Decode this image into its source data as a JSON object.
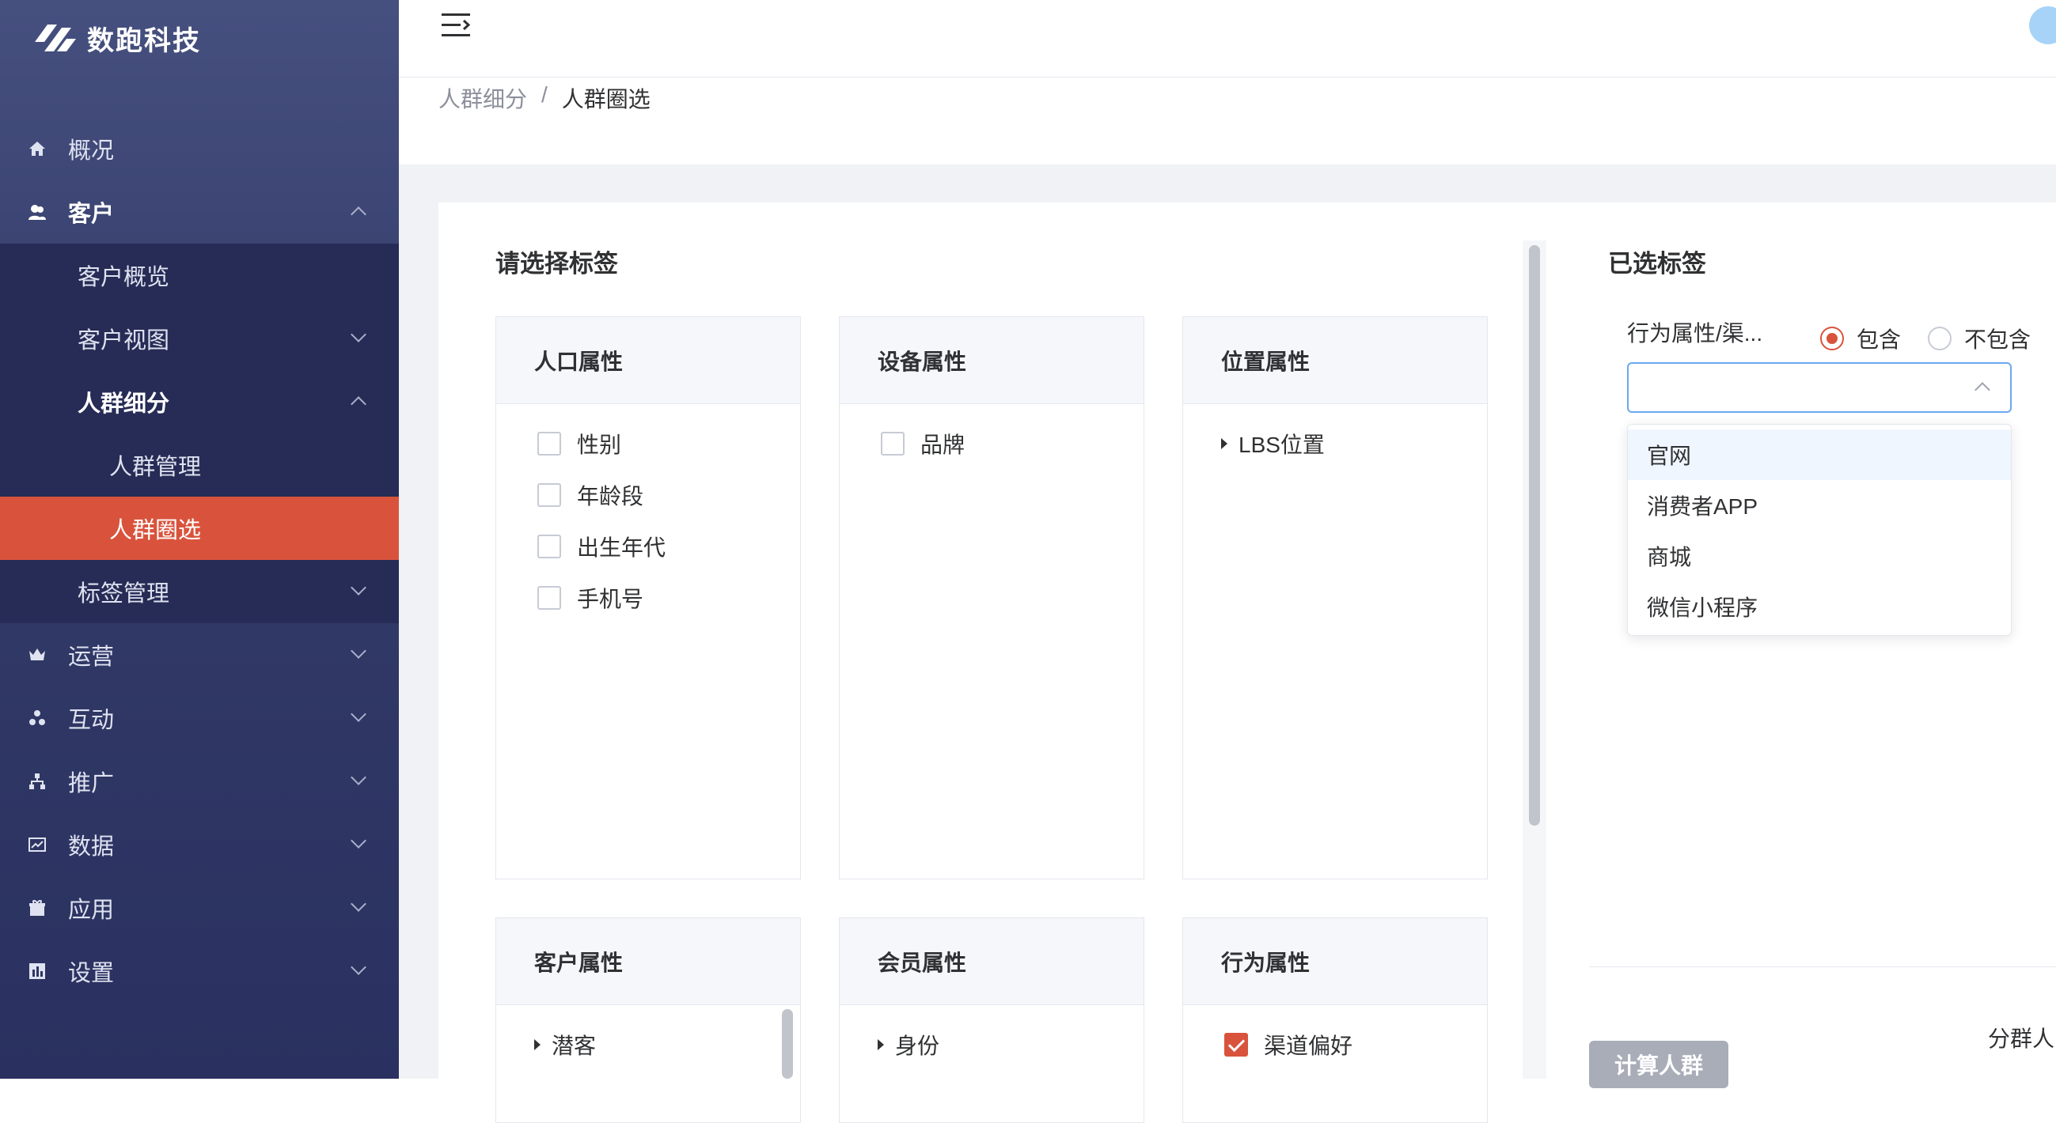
{
  "brand": {
    "name": "数跑科技"
  },
  "sidebar": {
    "items": [
      {
        "label": "概况",
        "icon": "home-icon"
      },
      {
        "label": "客户",
        "icon": "user-group-icon"
      },
      {
        "label": "客户概览"
      },
      {
        "label": "客户视图"
      },
      {
        "label": "人群细分"
      },
      {
        "label": "人群管理"
      },
      {
        "label": "人群圈选"
      },
      {
        "label": "标签管理"
      },
      {
        "label": "运营",
        "icon": "crown-icon"
      },
      {
        "label": "互动",
        "icon": "interaction-icon"
      },
      {
        "label": "推广",
        "icon": "sitemap-icon"
      },
      {
        "label": "数据",
        "icon": "chart-icon"
      },
      {
        "label": "应用",
        "icon": "gift-icon"
      },
      {
        "label": "设置",
        "icon": "bar-chart-icon"
      }
    ],
    "active_color": "#d9533c"
  },
  "breadcrumb": {
    "parent": "人群细分",
    "sep": "/",
    "current": "人群圈选"
  },
  "tags": {
    "title": "请选择标签",
    "panels": [
      {
        "title": "人口属性",
        "items": [
          "性别",
          "年龄段",
          "出生年代",
          "手机号"
        ]
      },
      {
        "title": "设备属性",
        "items": [
          "品牌"
        ]
      },
      {
        "title": "位置属性",
        "items": [
          "LBS位置"
        ]
      },
      {
        "title": "客户属性",
        "items": [
          "潜客"
        ]
      },
      {
        "title": "会员属性",
        "items": [
          "身份"
        ]
      },
      {
        "title": "行为属性",
        "items": [
          "渠道偏好"
        ]
      }
    ]
  },
  "selected": {
    "title": "已选标签",
    "tag_label": "行为属性/渠...",
    "radio_include": "包含",
    "radio_exclude": "不包含",
    "select_value": "",
    "options": [
      "官网",
      "消费者APP",
      "商城",
      "微信小程序"
    ]
  },
  "actions": {
    "calc_label": "计算人群",
    "split_label": "分群人"
  }
}
